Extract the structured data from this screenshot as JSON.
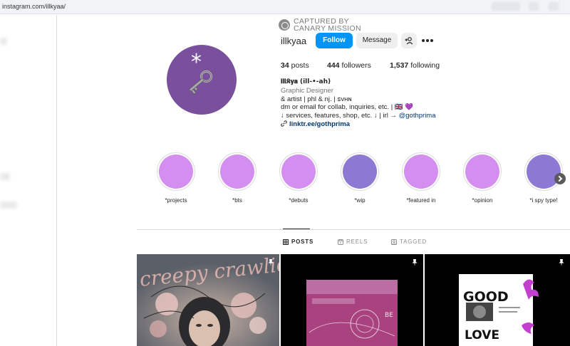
{
  "browser": {
    "url": "instagram.com/illkyaa/"
  },
  "watermark": {
    "line1": "CAPTURED BY",
    "line2": "CANARY MISSION"
  },
  "profile": {
    "username": "illkyaa",
    "follow_label": "Follow",
    "message_label": "Message",
    "stats": {
      "posts": {
        "count": "34",
        "label": "posts"
      },
      "followers": {
        "count": "444",
        "label": "followers"
      },
      "following": {
        "count": "1,537",
        "label": "following"
      }
    },
    "bio": {
      "name": "𝐢𝐥𝐥𝕶𝐲𝐚 (ill-•-ah)",
      "category": "Graphic Designer",
      "line1": "& artist | phl & nj. | ꜱᴠʜɴ",
      "line2": "dm or email for collab, inquiries, etc. | 🇬🇧 💜",
      "line3_prefix": "↓ services, features, shop, etc. ↓ | irl → ",
      "mention": "@gothprima",
      "link": "linktr.ee/gothprima"
    }
  },
  "highlights": [
    {
      "label": "*projects",
      "color": "#d48ef0"
    },
    {
      "label": "*bts",
      "color": "#d48ef0"
    },
    {
      "label": "*debuts",
      "color": "#d48ef0"
    },
    {
      "label": "*wip",
      "color": "#8d78d4"
    },
    {
      "label": "*featured in",
      "color": "#d48ef0"
    },
    {
      "label": "*opinion",
      "color": "#d48ef0"
    },
    {
      "label": "*i spy type!",
      "color": "#8d78d4"
    }
  ],
  "tabs": [
    {
      "label": "POSTS",
      "icon": "grid-icon",
      "active": true
    },
    {
      "label": "REELS",
      "icon": "reels-icon",
      "active": false
    },
    {
      "label": "TAGGED",
      "icon": "tagged-icon",
      "active": false
    }
  ],
  "posts": [
    {
      "art_text": "creepy crawlies",
      "pinned": true
    },
    {
      "art_text": "BE",
      "pinned": true
    },
    {
      "art_text_top": "GOOD",
      "art_text_bottom": "LOVE",
      "pinned": true
    }
  ],
  "colors": {
    "accent": "#0095f6",
    "avatar": "#7a4f9c",
    "link": "#00376b"
  }
}
